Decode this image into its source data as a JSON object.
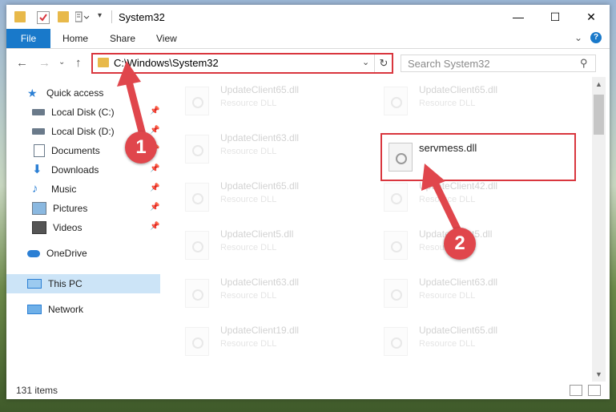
{
  "window": {
    "title": "System32"
  },
  "ribbon": {
    "file": "File",
    "tabs": [
      "Home",
      "Share",
      "View"
    ],
    "help": "?"
  },
  "nav": {
    "address": "C:\\Windows\\System32",
    "search_placeholder": "Search System32"
  },
  "sidebar": {
    "items": [
      {
        "label": "Quick access",
        "icon": "star-icon"
      },
      {
        "label": "Local Disk (C:)",
        "icon": "drive-icon"
      },
      {
        "label": "Local Disk (D:)",
        "icon": "drive-icon"
      },
      {
        "label": "Documents",
        "icon": "documents-icon"
      },
      {
        "label": "Downloads",
        "icon": "download-icon"
      },
      {
        "label": "Music",
        "icon": "music-icon"
      },
      {
        "label": "Pictures",
        "icon": "pictures-icon"
      },
      {
        "label": "Videos",
        "icon": "videos-icon"
      },
      {
        "label": "OneDrive",
        "icon": "cloud-icon"
      },
      {
        "label": "This PC",
        "icon": "computer-icon"
      },
      {
        "label": "Network",
        "icon": "network-icon"
      }
    ]
  },
  "files": {
    "col1": [
      {
        "name": "UpdateClient65.dll",
        "type": "Resource DLL"
      },
      {
        "name": "UpdateClient63.dll",
        "type": "Resource DLL"
      },
      {
        "name": "UpdateClient65.dll",
        "type": "Resource DLL"
      },
      {
        "name": "UpdateClient5.dll",
        "type": "Resource DLL"
      },
      {
        "name": "UpdateClient63.dll",
        "type": "Resource DLL"
      },
      {
        "name": "UpdateClient19.dll",
        "type": "Resource DLL"
      }
    ],
    "col2": [
      {
        "name": "UpdateClient65.dll",
        "type": "Resource DLL"
      },
      {
        "name": "servmess.dll",
        "type": ""
      },
      {
        "name": "UpdateClient42.dll",
        "type": "Resource DLL"
      },
      {
        "name": "UpdateClient5.dll",
        "type": "Resource DLL"
      },
      {
        "name": "UpdateClient63.dll",
        "type": "Resource DLL"
      },
      {
        "name": "UpdateClient65.dll",
        "type": "Resource DLL"
      }
    ]
  },
  "status": {
    "count": "131 items"
  },
  "callouts": {
    "one": "1",
    "two": "2"
  },
  "colors": {
    "accent": "#1979ca",
    "highlight": "#d9363e",
    "selected": "#cce4f7"
  }
}
